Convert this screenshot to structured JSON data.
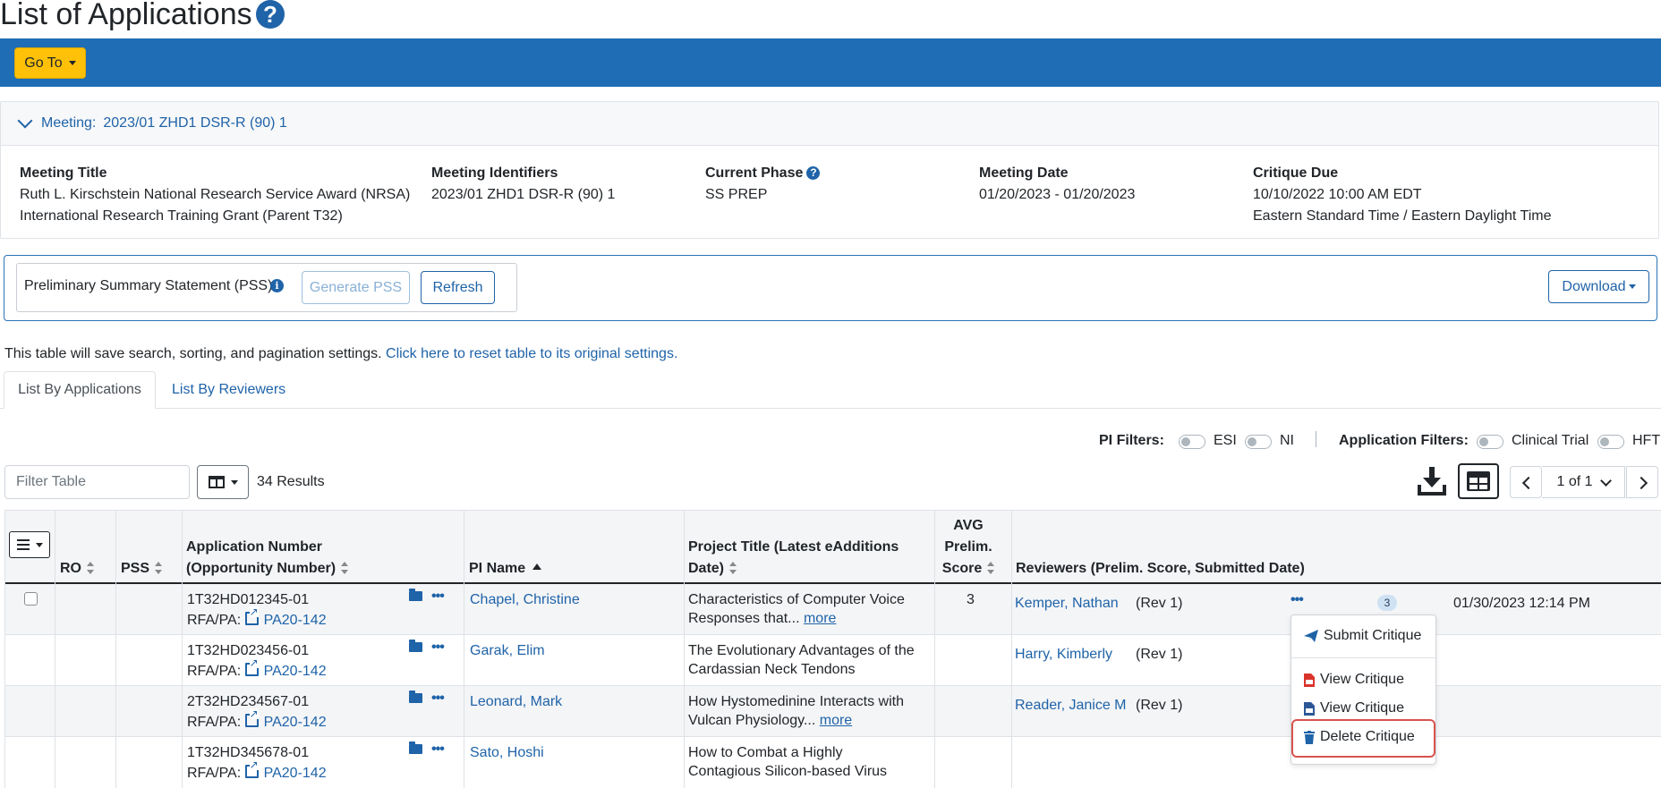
{
  "page": {
    "title": "List of Applications"
  },
  "goto": {
    "label": "Go To"
  },
  "meeting": {
    "toggle_prefix": "Meeting:",
    "toggle_value": "2023/01 ZHD1 DSR-R (90) 1",
    "title_label": "Meeting Title",
    "title_line1": "Ruth L. Kirschstein National Research Service Award (NRSA)",
    "title_line2": "International Research Training Grant (Parent T32)",
    "identifiers_label": "Meeting Identifiers",
    "identifiers_value": "2023/01 ZHD1 DSR-R (90) 1",
    "phase_label": "Current Phase",
    "phase_value": "SS PREP",
    "date_label": "Meeting Date",
    "date_value": "01/20/2023 - 01/20/2023",
    "critique_label": "Critique Due",
    "critique_line1": "10/10/2022 10:00 AM EDT",
    "critique_line2": "Eastern Standard Time / Eastern Daylight Time"
  },
  "pss": {
    "label": "Preliminary Summary Statement (PSS)",
    "generate_label": "Generate PSS",
    "refresh_label": "Refresh",
    "download_label": "Download"
  },
  "save_note": {
    "text": "This table will save search, sorting, and pagination settings. ",
    "link": "Click here to reset table to its original settings."
  },
  "tabs": [
    {
      "label": "List By Applications",
      "active": true
    },
    {
      "label": "List By Reviewers",
      "active": false
    }
  ],
  "filters": {
    "pi_label": "PI Filters:",
    "esi": "ESI",
    "ni": "NI",
    "app_label": "Application Filters:",
    "clinical": "Clinical Trial",
    "hft": "HFT"
  },
  "toolbar": {
    "filter_placeholder": "Filter Table",
    "results": "34 Results",
    "page_label": "1 of 1"
  },
  "table": {
    "headers": {
      "ro": "RO",
      "pss": "PSS",
      "app_line1": "Application Number",
      "app_line2": "(Opportunity Number)",
      "pi": "PI Name",
      "proj_line1": "Project Title (Latest eAdditions",
      "proj_line2": "Date)",
      "avg_line1": "AVG",
      "avg_line2": "Prelim.",
      "avg_line3": "Score",
      "reviewers": "Reviewers (Prelim. Score, Submitted Date)"
    },
    "rows": [
      {
        "app": "1T32HD012345-01",
        "rfa_label": "RFA/PA:",
        "rfa": "PA20-142",
        "pi": "Chapel, Christine",
        "title1": "Characteristics of Computer Voice",
        "title2": "Responses that...",
        "more": "more",
        "avg": "3",
        "reviewer": "Kemper, Nathan",
        "rev": "(Rev 1)",
        "count": "3",
        "submitted": "01/30/2023 12:14 PM"
      },
      {
        "app": "1T32HD023456-01",
        "rfa_label": "RFA/PA:",
        "rfa": "PA20-142",
        "pi": "Garak, Elim",
        "title1": "The Evolutionary Advantages of the",
        "title2": "Cardassian Neck Tendons",
        "more": "",
        "avg": "",
        "reviewer": "Harry, Kimberly",
        "rev": "(Rev 1)"
      },
      {
        "app": "2T32HD234567-01",
        "rfa_label": "RFA/PA:",
        "rfa": "PA20-142",
        "pi": "Leonard, Mark",
        "title1": "How Hystomedinine Interacts with",
        "title2": "Vulcan Physiology...",
        "more": "more",
        "avg": "",
        "reviewer": "Reader, Janice M",
        "rev": "(Rev 1)"
      },
      {
        "app": "1T32HD345678-01",
        "rfa_label": "RFA/PA:",
        "rfa": "PA20-142",
        "pi": "Sato, Hoshi",
        "title1": "How to Combat a Highly",
        "title2": "Contagious Silicon-based Virus",
        "more": "",
        "avg": "",
        "reviewer": "",
        "rev": ""
      }
    ]
  },
  "menu": {
    "submit": "Submit Critique",
    "view_pdf": "View Critique",
    "view_doc": "View Critique",
    "delete": "Delete Critique"
  },
  "colors": {
    "brand_bar": "#1f6db4",
    "accent": "#ffc107",
    "link": "#1f63a8",
    "highlight": "#d9534f"
  }
}
